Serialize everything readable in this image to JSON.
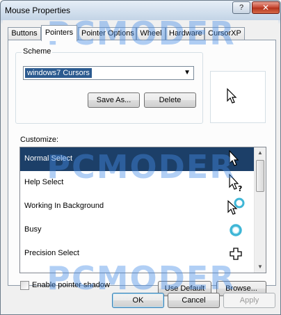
{
  "window": {
    "title": "Mouse Properties",
    "help_label": "?",
    "close_label": "✕"
  },
  "tabs": [
    {
      "label": "Buttons"
    },
    {
      "label": "Pointers"
    },
    {
      "label": "Pointer Options"
    },
    {
      "label": "Wheel"
    },
    {
      "label": "Hardware"
    },
    {
      "label": "CursorXP"
    }
  ],
  "active_tab": "Pointers",
  "scheme": {
    "label": "Scheme",
    "selected": "windows7 Cursors",
    "save_as_label": "Save As...",
    "delete_label": "Delete"
  },
  "customize": {
    "label": "Customize:",
    "items": [
      {
        "label": "Normal Select",
        "icon": "arrow-cursor-icon",
        "selected": true
      },
      {
        "label": "Help Select",
        "icon": "help-cursor-icon",
        "selected": false
      },
      {
        "label": "Working In Background",
        "icon": "working-cursor-icon",
        "selected": false
      },
      {
        "label": "Busy",
        "icon": "busy-cursor-icon",
        "selected": false
      },
      {
        "label": "Precision Select",
        "icon": "precision-cursor-icon",
        "selected": false
      }
    ]
  },
  "pointer_shadow": {
    "label": "Enable pointer shadow",
    "checked": false
  },
  "buttons": {
    "use_default": "Use Default",
    "browse": "Browse...",
    "ok": "OK",
    "cancel": "Cancel",
    "apply": "Apply"
  },
  "watermark": "PCMODER",
  "colors": {
    "selection": "#1c3f68",
    "watermark": "#468ce6"
  }
}
